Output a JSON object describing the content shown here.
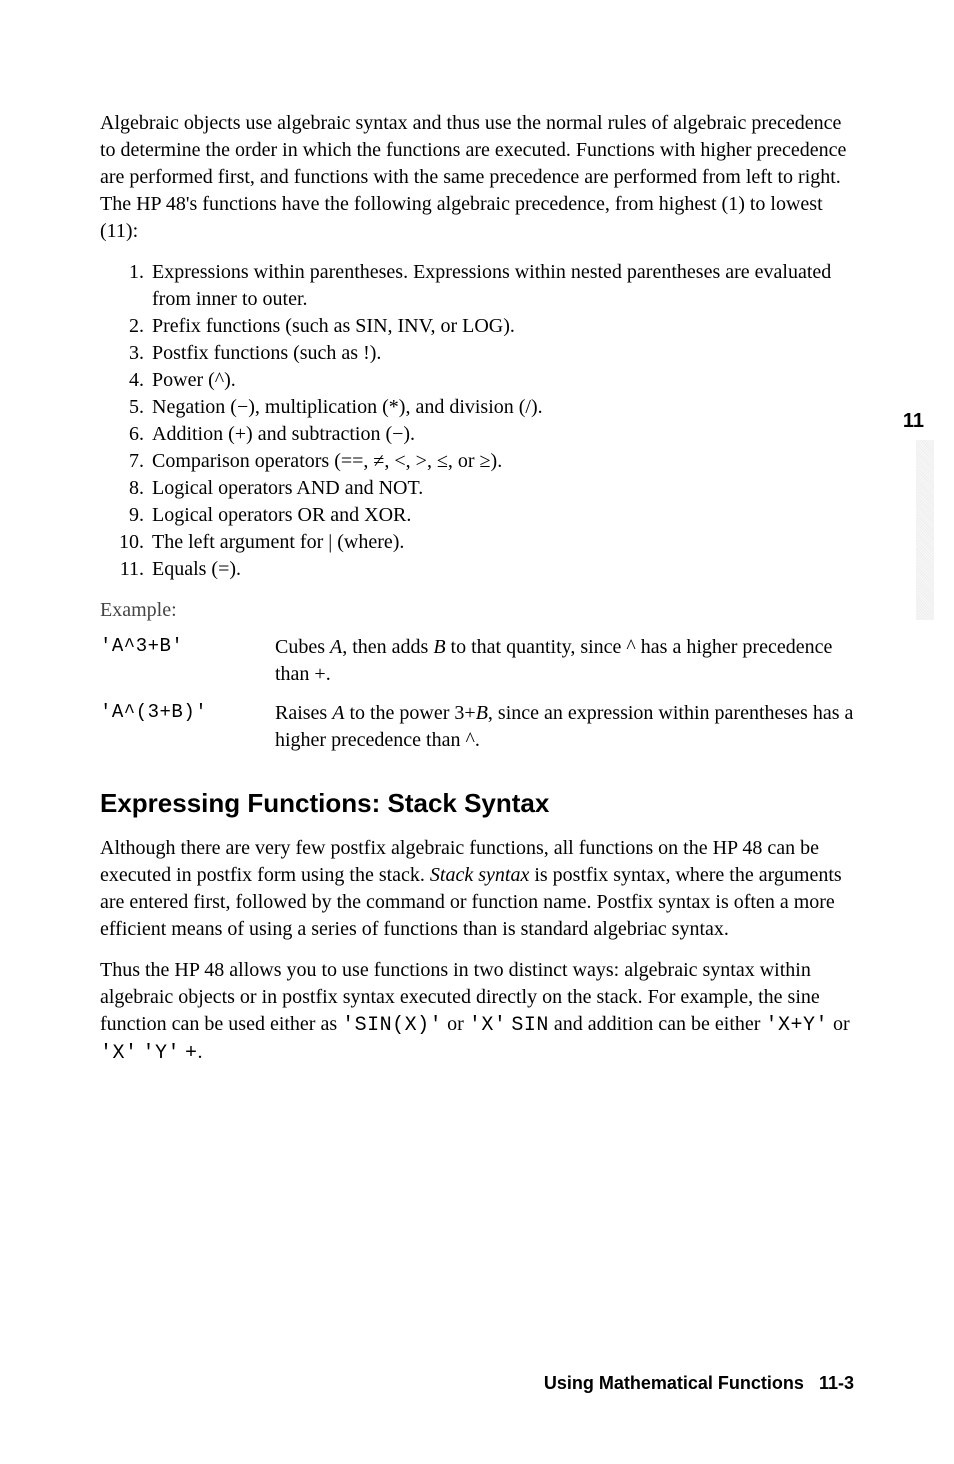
{
  "chapter_tab": "11",
  "intro_paragraph": "Algebraic objects use algebraic syntax and thus use the normal rules of algebraic precedence to determine the order in which the functions are executed. Functions with higher precedence are performed first, and functions with the same precedence are performed from left to right. The HP 48's functions have the following algebraic precedence, from highest (1) to lowest (11):",
  "precedence_list": [
    {
      "num": "1.",
      "text": "Expressions within parentheses. Expressions within nested parentheses are evaluated from inner to outer."
    },
    {
      "num": "2.",
      "text": "Prefix functions (such as SIN, INV, or LOG)."
    },
    {
      "num": "3.",
      "text": "Postfix functions (such as !)."
    },
    {
      "num": "4.",
      "text": "Power (^)."
    },
    {
      "num": "5.",
      "text": "Negation (−), multiplication (*), and division (/)."
    },
    {
      "num": "6.",
      "text": "Addition (+) and subtraction (−)."
    },
    {
      "num": "7.",
      "text": "Comparison operators (==, ≠, <, >, ≤, or ≥)."
    },
    {
      "num": "8.",
      "text": "Logical operators AND and NOT."
    },
    {
      "num": "9.",
      "text": "Logical operators OR and XOR."
    },
    {
      "num": "10.",
      "text": "The left argument for | (where)."
    },
    {
      "num": "11.",
      "text": "Equals (=)."
    }
  ],
  "example_label": "Example:",
  "examples": [
    {
      "code": "'A^3+B'",
      "desc_prefix": "Cubes ",
      "desc_a": "A",
      "desc_mid1": ", then adds ",
      "desc_b": "B",
      "desc_suffix": " to that quantity, since ^ has a higher precedence than +."
    },
    {
      "code": "'A^(3+B)'",
      "desc_prefix": "Raises ",
      "desc_a": "A",
      "desc_mid1": " to the power 3+",
      "desc_b": "B",
      "desc_suffix": ", since an expression within parentheses has a higher precedence than ^."
    }
  ],
  "heading": "Expressing Functions: Stack Syntax",
  "para2_prefix": "Although there are very few postfix algebraic functions, all functions on the HP 48 can be executed in postfix form using the stack. ",
  "para2_italic": "Stack syntax",
  "para2_suffix": " is postfix syntax, where the arguments are entered first, followed by the command or function name. Postfix syntax is often a more efficient means of using a series of functions than is standard algebriac syntax.",
  "para3_prefix": "Thus the HP 48 allows you to use functions in two distinct ways: algebraic syntax within algebraic objects or in postfix syntax executed directly on the stack. For example, the sine function can be used either as ",
  "para3_code1": "'SIN(X)'",
  "para3_mid1": " or ",
  "para3_code2": "'X'",
  "para3_mid2": " ",
  "para3_code3": "SIN",
  "para3_mid3": " and addition can be either ",
  "para3_code4": "'X+Y'",
  "para3_mid4": " or ",
  "para3_code5": "'X'",
  "para3_mid5": " ",
  "para3_code6": "'Y'",
  "para3_mid6": " ",
  "para3_code7": "+",
  "para3_suffix": ".",
  "footer_label": "Using Mathematical Functions",
  "footer_page": "11-3"
}
